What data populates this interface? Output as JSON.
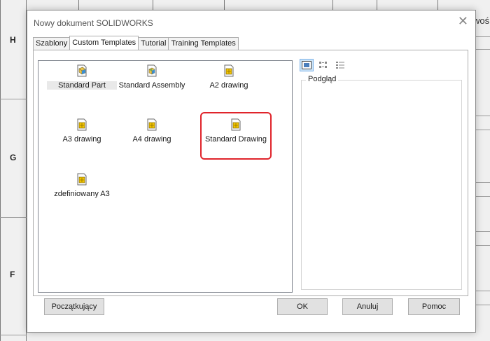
{
  "background": {
    "zone_letters": [
      "H",
      "G",
      "F"
    ],
    "corner_text": "woś"
  },
  "dialog": {
    "title": "Nowy dokument SOLIDWORKS",
    "close_glyph": "✕",
    "tabs": [
      {
        "label": "Szablony",
        "active": false
      },
      {
        "label": "Custom Templates",
        "active": true
      },
      {
        "label": "Tutorial",
        "active": false
      },
      {
        "label": "Training Templates",
        "active": false
      }
    ],
    "templates": [
      {
        "label": "Standard Part",
        "icon": "part-icon"
      },
      {
        "label": "Standard Assembly",
        "icon": "assembly-icon"
      },
      {
        "label": "A2 drawing",
        "icon": "drawing-icon"
      },
      {
        "label": "A3 drawing",
        "icon": "drawing-icon"
      },
      {
        "label": "A4 drawing",
        "icon": "drawing-icon"
      },
      {
        "label": "Standard Drawing",
        "icon": "drawing-icon"
      },
      {
        "label": "zdefiniowany A3",
        "icon": "drawing-icon"
      }
    ],
    "view_modes": [
      "large-icons-view-icon",
      "list-view-icon",
      "details-view-icon"
    ],
    "preview_label": "Podgląd",
    "buttons": {
      "novice": "Początkujący",
      "ok": "OK",
      "cancel": "Anuluj",
      "help": "Pomoc"
    },
    "colors": {
      "highlight": "#e0242b",
      "drawing_icon": "#f2c300",
      "part_icon": "#3a8fd4"
    }
  }
}
